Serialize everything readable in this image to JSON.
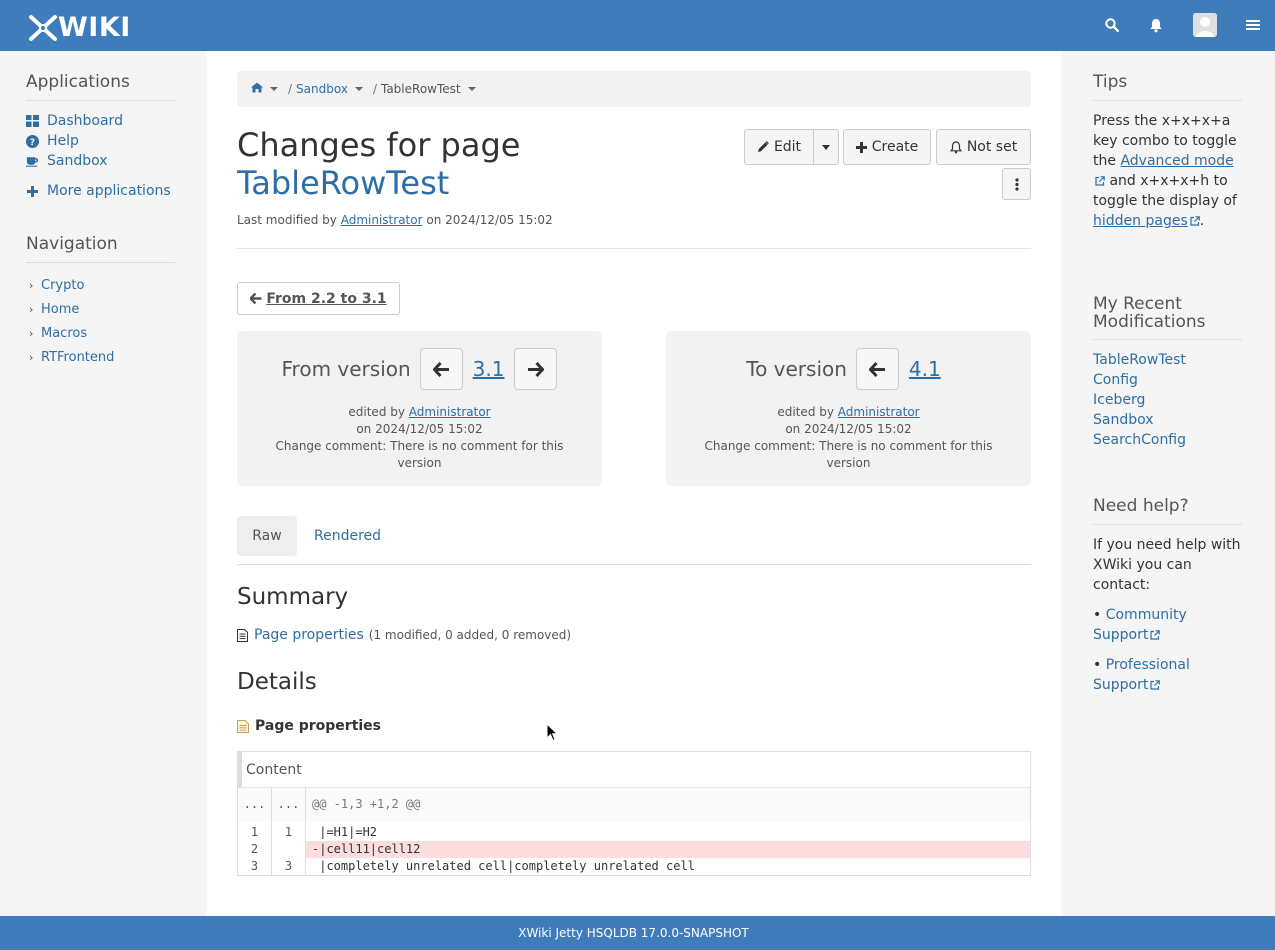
{
  "topbar": {
    "logo_text": "WIKI",
    "icons": [
      "search-icon",
      "bell-icon",
      "avatar",
      "hamburger-menu-icon"
    ],
    "color": "#3e7cbc"
  },
  "left": {
    "applications_title": "Applications",
    "apps": [
      {
        "label": "Dashboard",
        "icon": "dashboard-icon"
      },
      {
        "label": "Help",
        "icon": "question-circle-icon"
      },
      {
        "label": "Sandbox",
        "icon": "coffee-icon"
      }
    ],
    "more_apps": "More applications",
    "navigation_title": "Navigation",
    "nav": [
      "Crypto",
      "Home",
      "Macros",
      "RTFrontend"
    ]
  },
  "breadcrumb": {
    "items": [
      "Sandbox",
      "TableRowTest"
    ],
    "separator": "/"
  },
  "page": {
    "title_prefix": "Changes for page",
    "title_page": "TableRowTest",
    "last_modified_prefix": "Last modified by",
    "last_modified_user": "Administrator",
    "last_modified_on": "on 2024/12/05 15:02"
  },
  "actions": {
    "edit": "Edit",
    "create": "Create",
    "notset": "Not set"
  },
  "compare": {
    "prev_change": "From 2.2 to 3.1",
    "from": {
      "label": "From version",
      "version": "3.1",
      "edited_by_prefix": "edited by",
      "user": "Administrator",
      "on": "on 2024/12/05 15:02",
      "comment": "Change comment: There is no comment for this version"
    },
    "to": {
      "label": "To version",
      "version": "4.1",
      "edited_by_prefix": "edited by",
      "user": "Administrator",
      "on": "on 2024/12/05 15:02",
      "comment": "Change comment: There is no comment for this version"
    }
  },
  "tabs": {
    "raw": "Raw",
    "rendered": "Rendered"
  },
  "summary": {
    "title": "Summary",
    "link": "Page properties",
    "counts": "(1 modified, 0 added, 0 removed)"
  },
  "details": {
    "title": "Details",
    "section": "Page properties",
    "field": "Content",
    "hunk_left": "...",
    "hunk_right": "...",
    "hunk": "@@ -1,3 +1,2 @@",
    "lines": [
      {
        "n1": "1",
        "n2": "1",
        "text": " |=H1|=H2",
        "type": "context"
      },
      {
        "n1": "2",
        "n2": "",
        "text": "-|cell11|cell12",
        "type": "del"
      },
      {
        "n1": "3",
        "n2": "3",
        "text": " |completely unrelated cell|completely unrelated cell",
        "type": "context"
      }
    ],
    "del_color": "#fcdddd"
  },
  "right": {
    "tips_title": "Tips",
    "tips_text_1": "Press the x+x+x+a key combo to toggle the ",
    "tips_link_1": "Advanced mode",
    "tips_text_2": " and x+x+x+h to toggle the display of ",
    "tips_link_2": "hidden pages",
    "tips_text_3": ".",
    "recent_title": "My Recent Modifications",
    "recent": [
      "TableRowTest",
      "Config",
      "Iceberg",
      "Sandbox",
      "SearchConfig"
    ],
    "help_title": "Need help?",
    "help_text": "If you need help with XWiki you can contact:",
    "help_links": [
      "Community Support",
      "Professional Support"
    ]
  },
  "footer": {
    "text": "XWiki Jetty HSQLDB 17.0.0-SNAPSHOT"
  }
}
